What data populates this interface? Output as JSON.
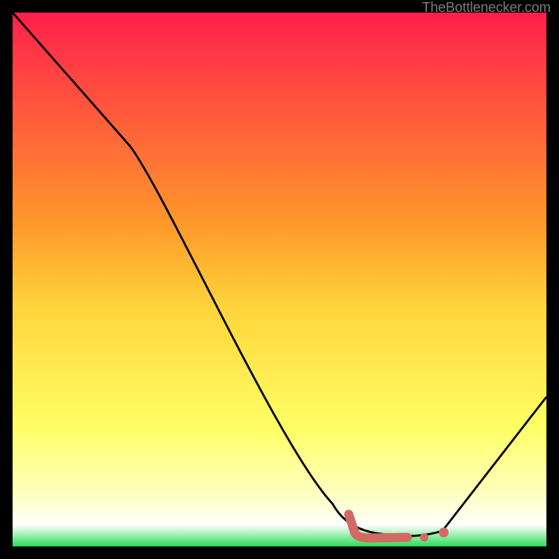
{
  "watermark": "TheBottlenecker.com",
  "chart_data": {
    "type": "line",
    "title": "",
    "xlabel": "",
    "ylabel": "",
    "xlim": [
      0,
      100
    ],
    "ylim": [
      0,
      100
    ],
    "grid": false,
    "background_gradient": {
      "stops": [
        {
          "offset": 0,
          "color": "#ff1f4b"
        },
        {
          "offset": 40,
          "color": "#ff9a2a"
        },
        {
          "offset": 55,
          "color": "#ffd43a"
        },
        {
          "offset": 78,
          "color": "#ffff66"
        },
        {
          "offset": 90,
          "color": "#ffffbe"
        },
        {
          "offset": 96,
          "color": "#ffffff"
        },
        {
          "offset": 100,
          "color": "#2bdc55"
        }
      ]
    },
    "series": [
      {
        "name": "bottleneck-curve",
        "type": "line",
        "color": "#000000",
        "points": [
          {
            "x": 0,
            "y": 100
          },
          {
            "x": 22,
            "y": 75
          },
          {
            "x": 60,
            "y": 8
          },
          {
            "x": 63,
            "y": 4
          },
          {
            "x": 68,
            "y": 2.5
          },
          {
            "x": 76,
            "y": 1.5
          },
          {
            "x": 82,
            "y": 3
          },
          {
            "x": 100,
            "y": 28
          }
        ]
      },
      {
        "name": "highlight-segment",
        "type": "line",
        "color": "#d26a63",
        "points": [
          {
            "x": 63,
            "y": 6
          },
          {
            "x": 64,
            "y": 2.5
          },
          {
            "x": 70,
            "y": 2
          },
          {
            "x": 74,
            "y": 2
          }
        ]
      },
      {
        "name": "highlight-dots",
        "type": "scatter",
        "color": "#d26a63",
        "points": [
          {
            "x": 77,
            "y": 2
          },
          {
            "x": 80.5,
            "y": 2.5
          }
        ]
      }
    ]
  }
}
